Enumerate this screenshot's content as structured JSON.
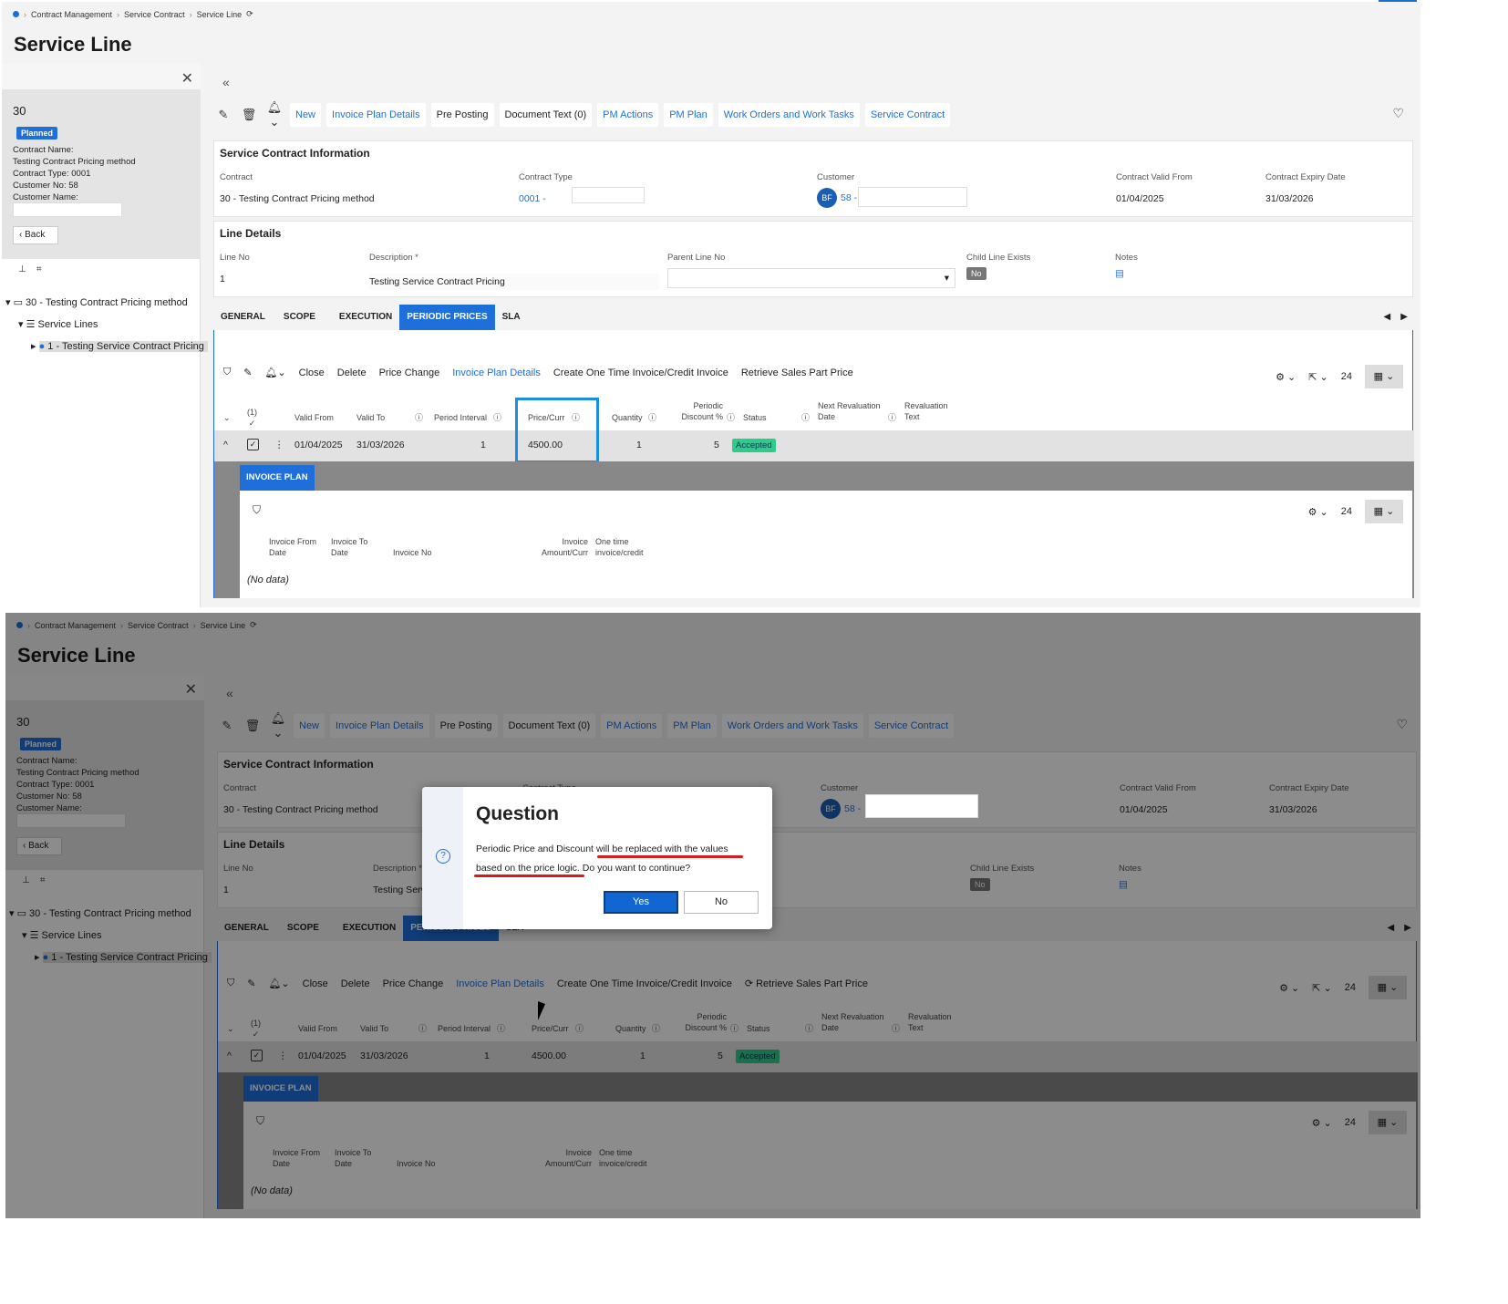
{
  "breadcrumb": {
    "items": [
      "Contract Management",
      "Service Contract",
      "Service Line"
    ]
  },
  "page": {
    "title": "Service Line"
  },
  "side": {
    "number": "30",
    "status": "Planned",
    "info": [
      "Contract Name:",
      "Testing Contract Pricing method",
      "Contract Type:  0001",
      "Customer No:  58",
      "Customer Name:"
    ],
    "back": "Back",
    "tree": [
      "30 - Testing Contract Pricing method",
      "Service Lines",
      "1 - Testing Service Contract Pricing"
    ]
  },
  "toolbar": {
    "new": "New",
    "invoice_plan_details": "Invoice Plan Details",
    "pre_posting": "Pre Posting",
    "document_text": "Document Text (0)",
    "pm_actions": "PM Actions",
    "pm_plan": "PM Plan",
    "work_orders": "Work Orders and Work Tasks",
    "service_contract": "Service Contract"
  },
  "contract_info": {
    "title": "Service Contract Information",
    "contract_label": "Contract",
    "contract_value": "30 - Testing Contract Pricing method",
    "type_label": "Contract Type",
    "type_value": "0001 -",
    "customer_label": "Customer",
    "customer_avatar": "BF",
    "customer_value": "58 -",
    "valid_from_label": "Contract Valid From",
    "valid_from_value": "01/04/2025",
    "expiry_label": "Contract Expiry Date",
    "expiry_value": "31/03/2026"
  },
  "line_details": {
    "title": "Line Details",
    "line_no_label": "Line No",
    "line_no_value": "1",
    "desc_label": "Description *",
    "desc_value": "Testing Service Contract Pricing",
    "parent_label": "Parent Line No",
    "child_label": "Child Line Exists",
    "child_value": "No",
    "notes_label": "Notes"
  },
  "tabs": [
    "GENERAL",
    "SCOPE",
    "EXECUTION",
    "PERIODIC PRICES",
    "SLA"
  ],
  "grid_toolbar": {
    "close": "Close",
    "delete": "Delete",
    "price_change": "Price Change",
    "invoice_plan_details": "Invoice Plan Details",
    "create_one_time": "Create One Time Invoice/Credit Invoice",
    "retrieve": "Retrieve Sales Part Price",
    "page_size": "24"
  },
  "grid": {
    "sel_count": "(1)",
    "headers": {
      "valid_from": "Valid From",
      "valid_to": "Valid To",
      "period_interval": "Period Interval",
      "price": "Price/Curr",
      "quantity": "Quantity",
      "discount": "Periodic Discount %",
      "status": "Status",
      "next_reval": "Next Revaluation Date",
      "reval_text": "Revaluation Text"
    },
    "row": {
      "valid_from": "01/04/2025",
      "valid_to": "31/03/2026",
      "period_interval": "1",
      "price": "4500.00",
      "quantity": "1",
      "discount": "5",
      "status": "Accepted"
    }
  },
  "invoice_plan": {
    "tab": "INVOICE PLAN",
    "page_size": "24",
    "headers": {
      "from": "Invoice From Date",
      "to": "Invoice To Date",
      "no": "Invoice No",
      "amount": "Invoice Amount/Curr",
      "one_time": "One time invoice/credit"
    },
    "no_data": "(No data)"
  },
  "dialog": {
    "title": "Question",
    "message": "Periodic Price and Discount will be replaced with the values based on the price logic. Do you want to continue?",
    "yes": "Yes",
    "no": "No"
  },
  "colors": {
    "accent": "#1e6fd9",
    "status_accepted": "#2ecc8a",
    "highlight": "#1a8fe0",
    "underline": "#d51c1c"
  }
}
